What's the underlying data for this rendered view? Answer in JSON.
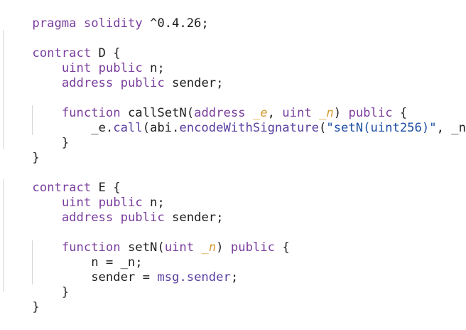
{
  "code": {
    "l1": {
      "a": "pragma solidity",
      "b": " ^0.4.26;"
    },
    "l3": {
      "a": "contract",
      "b": " D {"
    },
    "l4": {
      "a": "    ",
      "b": "uint",
      "c": " ",
      "d": "public",
      "e": " n;"
    },
    "l5": {
      "a": "    ",
      "b": "address",
      "c": " ",
      "d": "public",
      "e": " sender;"
    },
    "l7": {
      "a": "    ",
      "b": "function",
      "c": " callSetN(",
      "d": "address",
      "e": " ",
      "f": "_e",
      "g": ", ",
      "h": "uint",
      "i": " ",
      "j": "_n",
      "k": ") ",
      "l": "public",
      "m": " {"
    },
    "l8": {
      "a": "        _e.",
      "b": "call",
      "c": "(abi.",
      "d": "encodeWithSignature",
      "e": "(",
      "f": "\"setN(uint256)\"",
      "g": ", _n));"
    },
    "l9": {
      "a": "    }"
    },
    "l10": {
      "a": "}"
    },
    "l12": {
      "a": "contract",
      "b": " E {"
    },
    "l13": {
      "a": "    ",
      "b": "uint",
      "c": " ",
      "d": "public",
      "e": " n;"
    },
    "l14": {
      "a": "    ",
      "b": "address",
      "c": " ",
      "d": "public",
      "e": " sender;"
    },
    "l16": {
      "a": "    ",
      "b": "function",
      "c": " setN(",
      "d": "uint",
      "e": " ",
      "f": "_n",
      "g": ") ",
      "h": "public",
      "i": " {"
    },
    "l17": {
      "a": "        n = _n;"
    },
    "l18": {
      "a": "        sender = ",
      "b": "msg.sender",
      "c": ";"
    },
    "l19": {
      "a": "    }"
    },
    "l20": {
      "a": "}"
    }
  }
}
